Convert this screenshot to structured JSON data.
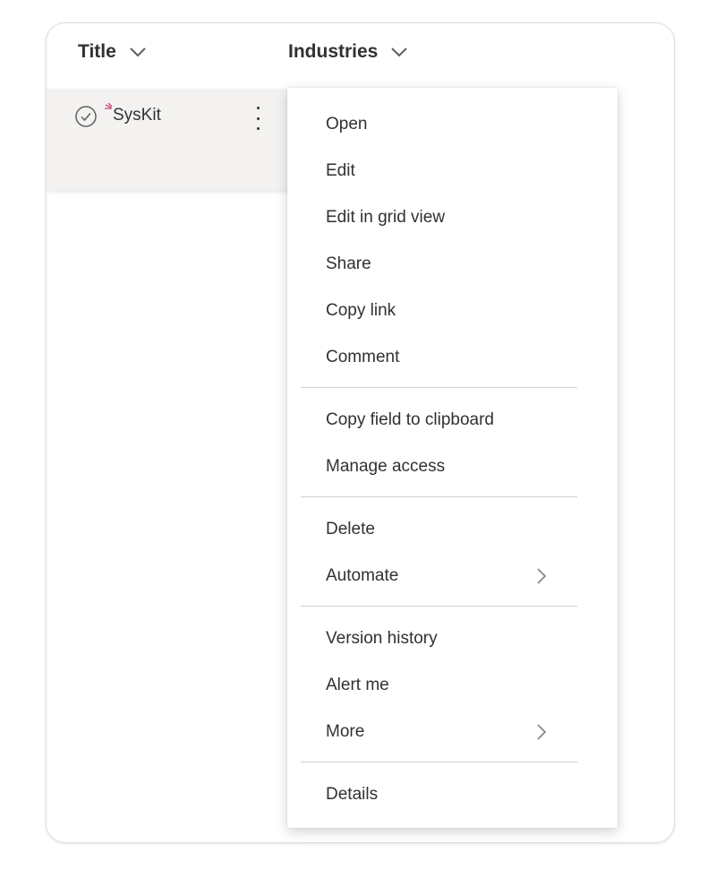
{
  "columns": {
    "title": "Title",
    "industries": "Industries"
  },
  "row": {
    "title": "SysKit"
  },
  "menu": {
    "open": "Open",
    "edit": "Edit",
    "edit_grid": "Edit in grid view",
    "share": "Share",
    "copy_link": "Copy link",
    "comment": "Comment",
    "copy_field": "Copy field to clipboard",
    "manage_access": "Manage access",
    "delete": "Delete",
    "automate": "Automate",
    "version_history": "Version history",
    "alert_me": "Alert me",
    "more": "More",
    "details": "Details"
  },
  "icons": {
    "column_sort": "chevron-down-icon",
    "row_select": "check-circle-icon",
    "new_item": "new-item-glimmer-icon",
    "row_actions": "more-vertical-icon",
    "submenu": "chevron-right-icon"
  },
  "colors": {
    "new_item_accent": "#c2185b",
    "row_selected_bg": "#f3f2f1"
  }
}
